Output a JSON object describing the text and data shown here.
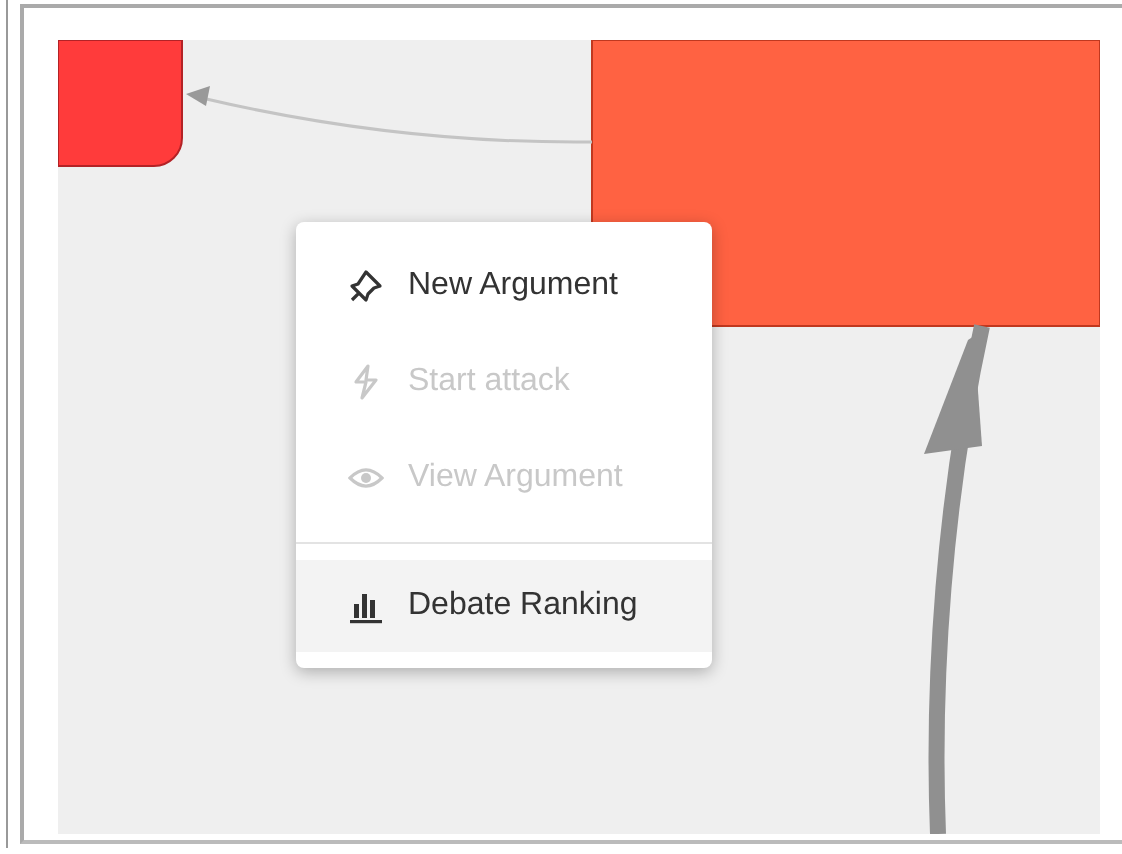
{
  "context_menu": {
    "items": [
      {
        "kind": "action",
        "label": "New Argument",
        "disabled": false,
        "highlighted": false
      },
      {
        "kind": "action",
        "label": "Start attack",
        "disabled": true,
        "highlighted": false
      },
      {
        "kind": "action",
        "label": "View Argument",
        "disabled": true,
        "highlighted": false
      },
      {
        "kind": "divider"
      },
      {
        "kind": "action",
        "label": "Debate Ranking",
        "disabled": false,
        "highlighted": true
      }
    ]
  }
}
